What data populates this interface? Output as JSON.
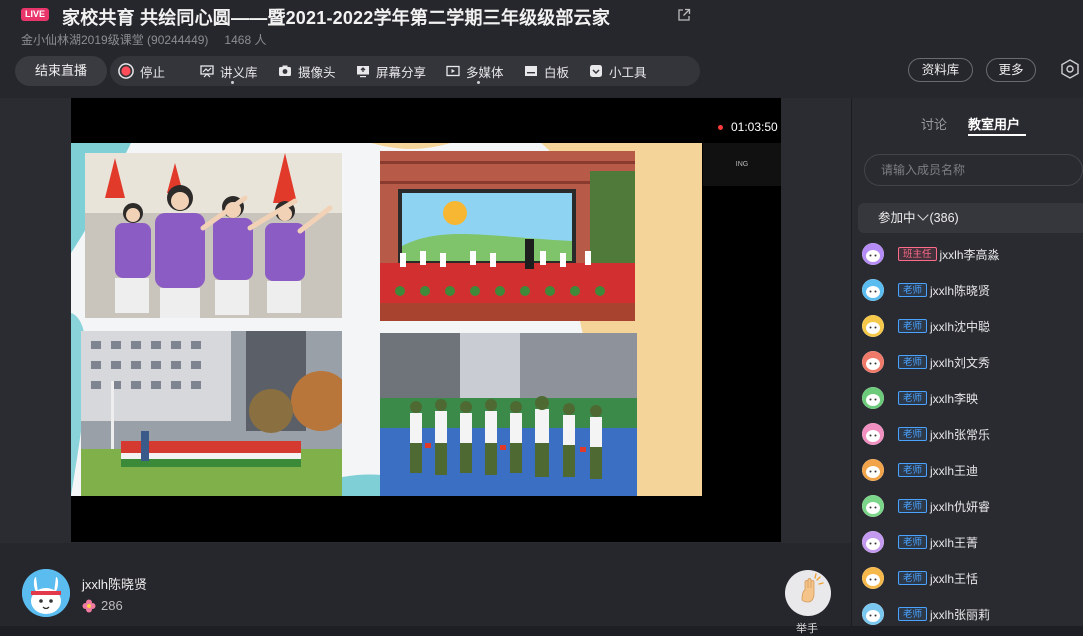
{
  "header": {
    "live_badge": "LIVE",
    "title": "家校共育 共绘同心圆——暨2021-2022学年第二学期三年级级部云家",
    "classroom": "金小仙林湖2019级课堂 (90244449)",
    "viewer_count": "1468 人"
  },
  "toolbar": {
    "end_live": "结束直播",
    "stop": "停止",
    "lecture_library": "讲义库",
    "camera": "摄像头",
    "screen_share": "屏幕分享",
    "multimedia": "多媒体",
    "whiteboard": "白板",
    "tools": "小工具",
    "resource_library": "资料库",
    "more": "更多"
  },
  "stage": {
    "timer": "01:03:50",
    "mini_tile_label": "ING"
  },
  "presenter": {
    "name": "jxxlh陈晓贤",
    "likes": "286",
    "raise_hand_label": "举手"
  },
  "panel": {
    "tab_discuss": "讨论",
    "tab_users": "教室用户",
    "search_placeholder": "请输入成员名称",
    "group_label": "参加中",
    "group_count": "(386)",
    "members": [
      {
        "role": "班主任",
        "name": "jxxlh李高淼",
        "role_type": "head",
        "avatar_color": "#b58cf5"
      },
      {
        "role": "老师",
        "name": "jxxlh陈晓贤",
        "role_type": "teacher",
        "avatar_color": "#5bbcf0"
      },
      {
        "role": "老师",
        "name": "jxxlh沈中聪",
        "role_type": "teacher",
        "avatar_color": "#f5c84a"
      },
      {
        "role": "老师",
        "name": "jxxlh刘文秀",
        "role_type": "teacher",
        "avatar_color": "#f07a6a"
      },
      {
        "role": "老师",
        "name": "jxxlh李映",
        "role_type": "teacher",
        "avatar_color": "#6ccb7a"
      },
      {
        "role": "老师",
        "name": "jxxlh张常乐",
        "role_type": "teacher",
        "avatar_color": "#f08fc0"
      },
      {
        "role": "老师",
        "name": "jxxlh王迪",
        "role_type": "teacher",
        "avatar_color": "#f2a44a"
      },
      {
        "role": "老师",
        "name": "jxxlh仇妍睿",
        "role_type": "teacher",
        "avatar_color": "#7bd68a"
      },
      {
        "role": "老师",
        "name": "jxxlh王菁",
        "role_type": "teacher",
        "avatar_color": "#c49af0"
      },
      {
        "role": "老师",
        "name": "jxxlh王恬",
        "role_type": "teacher",
        "avatar_color": "#f5b84a"
      },
      {
        "role": "老师",
        "name": "jxxlh张丽莉",
        "role_type": "teacher",
        "avatar_color": "#7ac8f0"
      }
    ]
  },
  "icons": {
    "share": "external-link-icon",
    "stop": "record-stop-icon",
    "lecture": "presentation-icon",
    "camera": "camera-icon",
    "screen": "screen-share-icon",
    "media": "media-icon",
    "whiteboard": "whiteboard-icon",
    "tools": "toolbox-icon",
    "settings": "hexagon-settings-icon",
    "like": "flower-like-icon",
    "raise_hand": "raise-hand-icon"
  },
  "colors": {
    "live_badge": "#e8366a",
    "rec_dot": "#ff3b3b",
    "head_teacher_tag": "#ff6b8a",
    "teacher_tag": "#4aa3ff"
  }
}
